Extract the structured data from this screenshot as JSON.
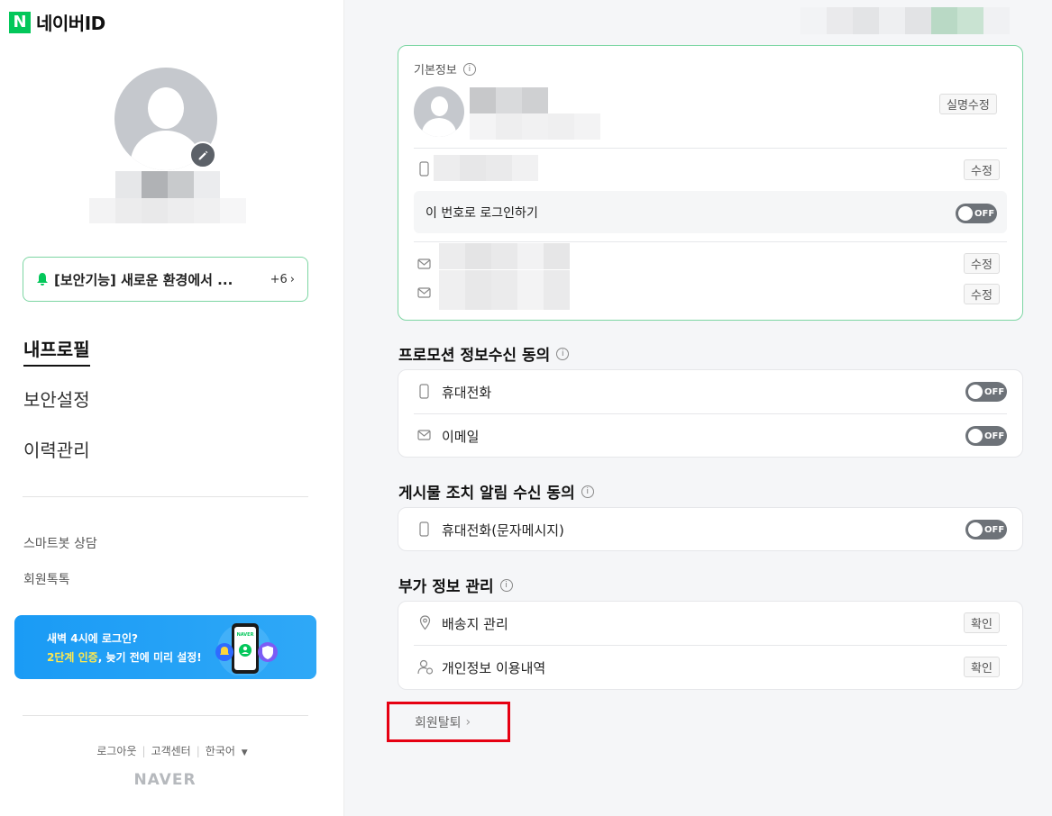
{
  "sidebar": {
    "logo_mark": "N",
    "logo_text": "네이버ID",
    "notice": {
      "text": "[보안기능] 새로운 환경에서 ...",
      "count": "+6"
    },
    "nav": [
      "내프로필",
      "보안설정",
      "이력관리"
    ],
    "links": [
      "스마트봇 상담",
      "회원톡톡"
    ],
    "banner": {
      "line1": "새벽 4시에 로그인?",
      "line2_highlight": "2단계 인증",
      "line2_rest": ", 늦기 전에 미리 설정!",
      "phone_label": "NAVER"
    },
    "footer": {
      "logout": "로그아웃",
      "help": "고객센터",
      "lang": "한국어"
    },
    "naver": "NAVER"
  },
  "basic": {
    "title": "기본정보",
    "name_edit": "실명수정",
    "edit": "수정",
    "login_with_number": "이 번호로 로그인하기",
    "toggle": "OFF"
  },
  "promotion": {
    "title": "프로모션 정보수신 동의",
    "phone": "휴대전화",
    "email": "이메일",
    "toggle": "OFF"
  },
  "post_alert": {
    "title": "게시물 조치 알림 수신 동의",
    "phone": "휴대전화(문자메시지)",
    "toggle": "OFF"
  },
  "extra": {
    "title": "부가 정보 관리",
    "shipping": "배송지 관리",
    "privacy": "개인정보 이용내역",
    "check": "확인"
  },
  "withdraw": "회원탈퇴",
  "colors": {
    "naver_green": "#03c75a",
    "highlight_red": "#e60012",
    "banner_blue": "#1a9bf5"
  }
}
